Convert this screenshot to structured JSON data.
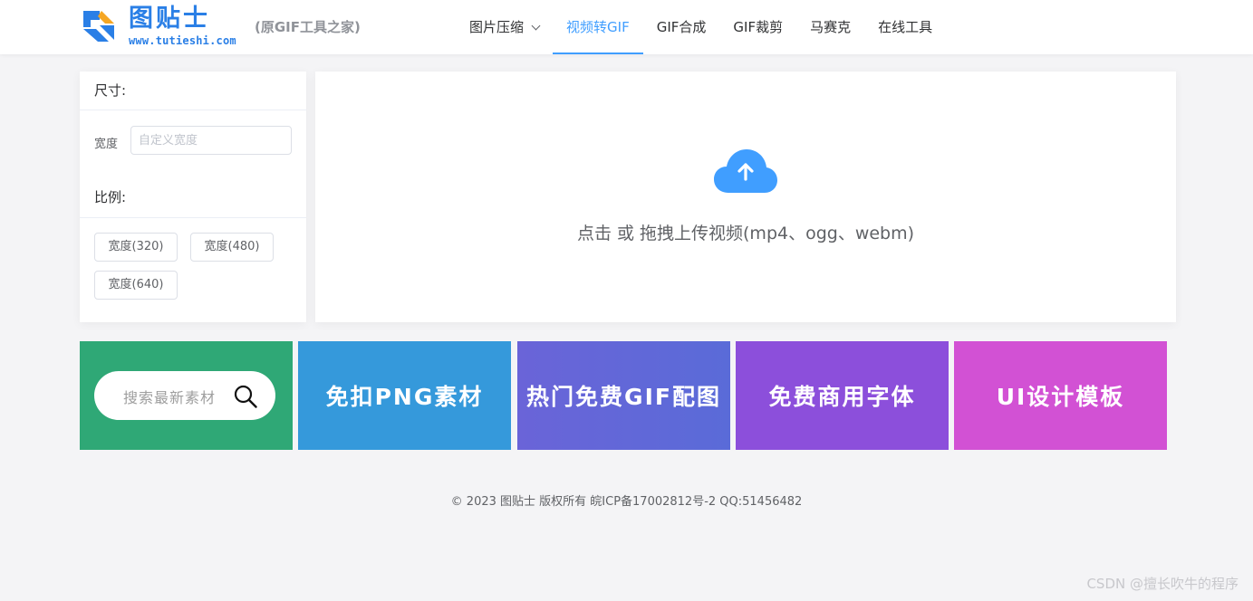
{
  "brand": {
    "title": "图贴士",
    "url": "www.tutieshi.com",
    "subtitle": "(原GIF工具之家)"
  },
  "nav": {
    "items": [
      {
        "label": "图片压缩"
      },
      {
        "label": "视频转GIF"
      },
      {
        "label": "GIF合成"
      },
      {
        "label": "GIF裁剪"
      },
      {
        "label": "马赛克"
      },
      {
        "label": "在线工具"
      }
    ],
    "active": "视频转GIF"
  },
  "settings": {
    "size_title": "尺寸:",
    "width_label": "宽度",
    "width_placeholder": "自定义宽度",
    "ratio_title": "比例:",
    "ratio_options": [
      "宽度(320)",
      "宽度(480)",
      "宽度(640)"
    ]
  },
  "upload": {
    "icon": "cloud-upload-icon",
    "text": "点击 或 拖拽上传视频(mp4、ogg、webm)",
    "accent": "#409eff"
  },
  "banners": {
    "search_placeholder": "搜索最新素材",
    "items": [
      {
        "label": "免扣PNG素材",
        "color": "#3599db"
      },
      {
        "label": "热门免费GIF配图",
        "color": "#5f69d8"
      },
      {
        "label": "免费商用字体",
        "color": "#8c4fdb"
      },
      {
        "label": "UI设计模板",
        "color": "#d251d4"
      }
    ],
    "search_color": "#2fa876"
  },
  "footer": {
    "text": "© 2023 图贴士 版权所有 皖ICP备17002812号-2 QQ:51456482"
  },
  "watermark": "CSDN @擅长吹牛的程序"
}
